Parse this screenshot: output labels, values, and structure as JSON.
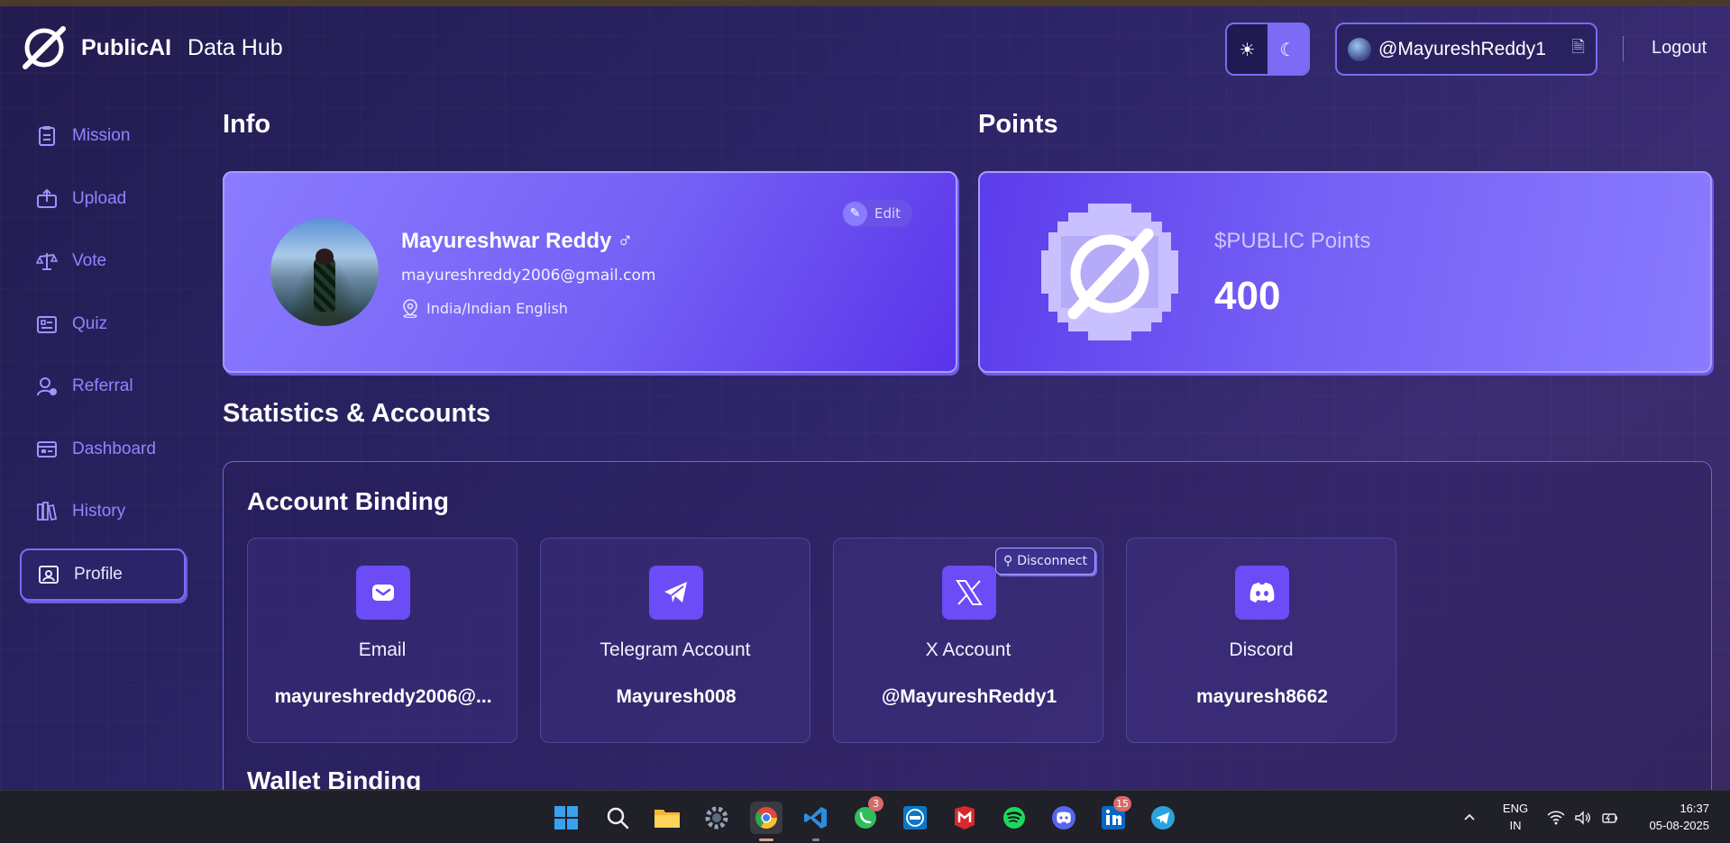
{
  "header": {
    "brand": "PublicAI",
    "brand_sub": "Data Hub",
    "username": "@MayureshReddy1",
    "logout_label": "Logout"
  },
  "sidebar": {
    "items": [
      {
        "label": "Mission",
        "icon": "clipboard-icon"
      },
      {
        "label": "Upload",
        "icon": "upload-icon"
      },
      {
        "label": "Vote",
        "icon": "scale-icon"
      },
      {
        "label": "Quiz",
        "icon": "quiz-icon"
      },
      {
        "label": "Referral",
        "icon": "referral-icon"
      },
      {
        "label": "Dashboard",
        "icon": "dashboard-icon"
      },
      {
        "label": "History",
        "icon": "history-icon"
      },
      {
        "label": "Profile",
        "icon": "profile-icon"
      }
    ],
    "active": "Profile"
  },
  "info": {
    "title": "Info",
    "name": "Mayureshwar Reddy",
    "gender_symbol": "♂",
    "email": "mayureshreddy2006@gmail.com",
    "location": "India/Indian English",
    "edit_label": "Edit"
  },
  "points": {
    "title": "Points",
    "label": "$PUBLIC Points",
    "value": "400"
  },
  "stats": {
    "title": "Statistics & Accounts",
    "account_binding_title": "Account Binding",
    "wallet_binding_title": "Wallet Binding",
    "accounts": [
      {
        "name": "Email",
        "value": "mayureshreddy2006@...",
        "icon": "mail-icon"
      },
      {
        "name": "Telegram Account",
        "value": "Mayuresh008",
        "icon": "telegram-icon"
      },
      {
        "name": "X Account",
        "value": "@MayureshReddy1",
        "icon": "x-icon"
      },
      {
        "name": "Discord",
        "value": "mayuresh8662",
        "icon": "discord-icon"
      }
    ],
    "disconnect_label": "Disconnect"
  },
  "taskbar": {
    "badges": {
      "whatsapp": "3",
      "linkedin": "15"
    },
    "lang_top": "ENG",
    "lang_bottom": "IN",
    "time": "16:37",
    "date": "05-08-2025"
  },
  "colors": {
    "accent": "#7c6cf5",
    "card_icon_bg": "#6b4cf6",
    "background": "#2b2466"
  }
}
